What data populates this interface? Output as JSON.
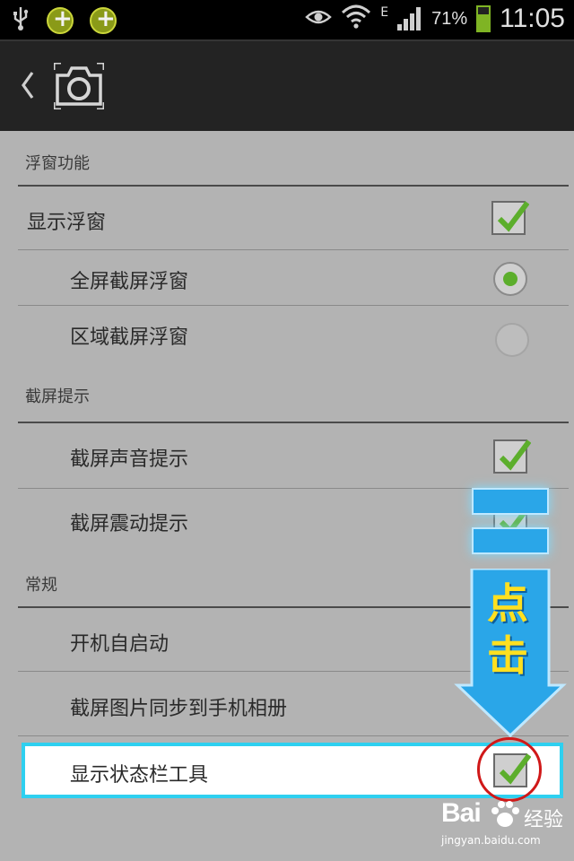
{
  "status_bar": {
    "battery_percent": "71%",
    "time": "11:05",
    "network_type": "E",
    "icons": [
      "usb-icon",
      "app-badge-icon",
      "app-badge-icon",
      "eye-icon",
      "wifi-icon",
      "signal-icon",
      "battery-icon"
    ]
  },
  "action_bar": {
    "back_icon": "chevron-left-icon",
    "app_icon": "camera-icon"
  },
  "sections": [
    {
      "header": "浮窗功能"
    },
    {
      "header": "截屏提示"
    },
    {
      "header": "常规"
    }
  ],
  "rows": {
    "show_float": {
      "label": "显示浮窗",
      "checked": true
    },
    "fullscreen_float": {
      "label": "全屏截屏浮窗",
      "selected": true
    },
    "region_float": {
      "label": "区域截屏浮窗",
      "selected": false
    },
    "sound_hint": {
      "label": "截屏声音提示",
      "checked": true
    },
    "vibrate_hint": {
      "label": "截屏震动提示",
      "checked": true
    },
    "autostart": {
      "label": "开机自启动"
    },
    "sync_album": {
      "label": "截屏图片同步到手机相册"
    },
    "status_tool": {
      "label": "显示状态栏工具",
      "checked": true
    }
  },
  "annotation": {
    "text_line1": "点",
    "text_line2": "击",
    "highlight_color": "#2ed0f0",
    "circle_color": "#d01818",
    "arrow_color": "#2aa6e8",
    "text_color": "#ffe020"
  },
  "watermark": {
    "brand": "Bai",
    "brand_suffix": "经验",
    "url": "jingyan.baidu.com"
  },
  "colors": {
    "check_green": "#5cae2c",
    "page_bg": "#b3b3b3",
    "action_bar_bg": "#232323"
  }
}
